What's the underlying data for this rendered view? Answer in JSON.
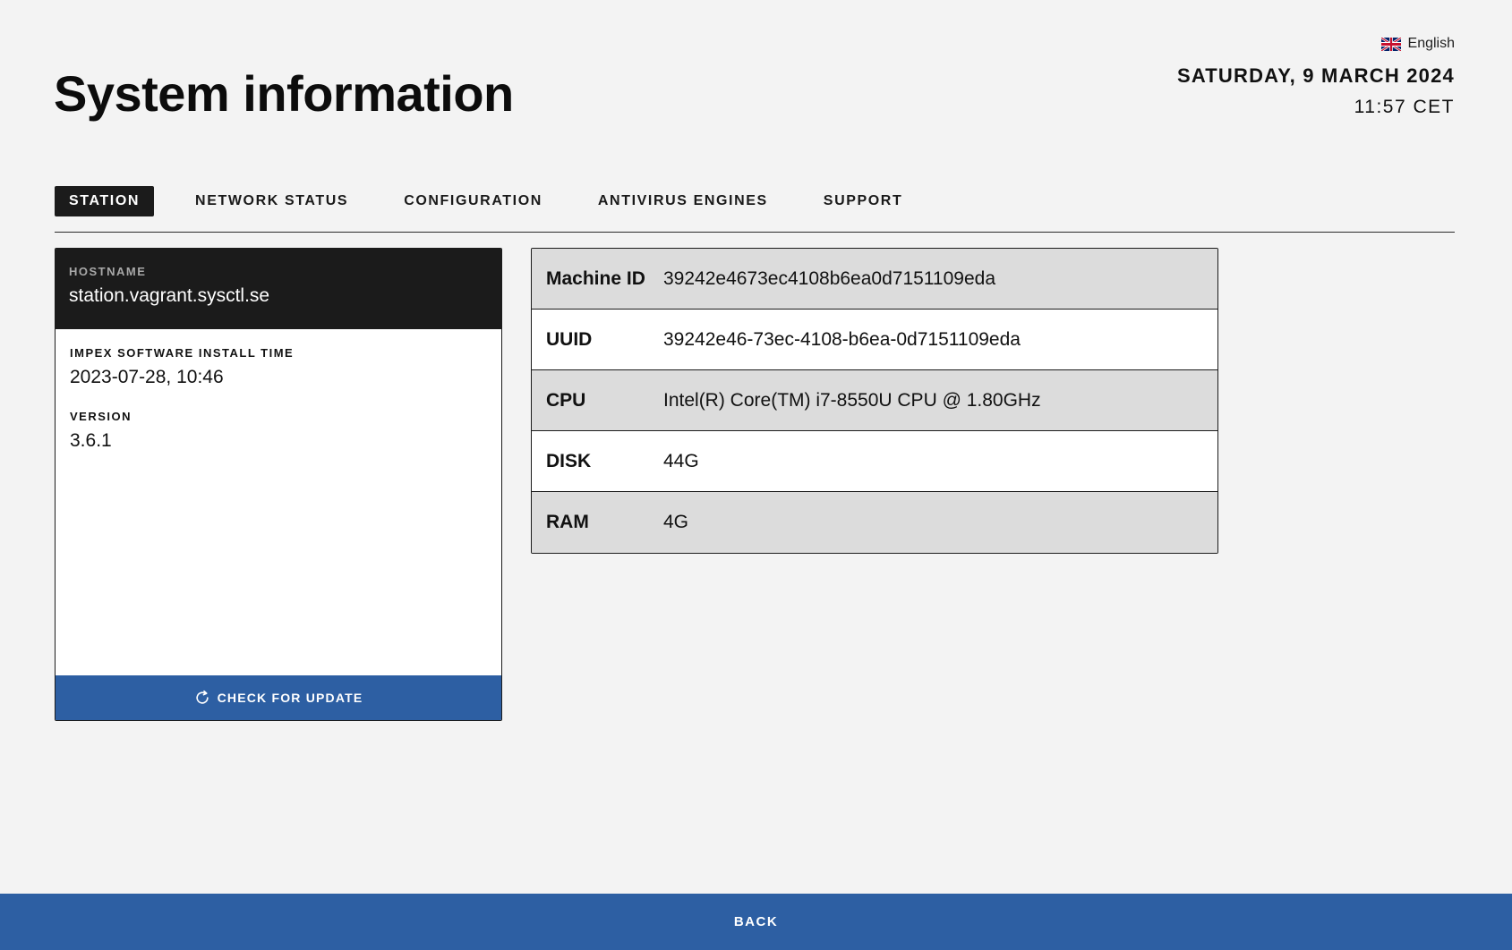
{
  "header": {
    "title": "System information",
    "language": "English",
    "date": "SATURDAY, 9 MARCH 2024",
    "time": "11:57 CET"
  },
  "tabs": [
    {
      "label": "STATION",
      "active": true
    },
    {
      "label": "NETWORK STATUS",
      "active": false
    },
    {
      "label": "CONFIGURATION",
      "active": false
    },
    {
      "label": "ANTIVIRUS ENGINES",
      "active": false
    },
    {
      "label": "SUPPORT",
      "active": false
    }
  ],
  "station": {
    "hostname_label": "HOSTNAME",
    "hostname": "station.vagrant.sysctl.se",
    "install_time_label": "IMPEX SOFTWARE INSTALL TIME",
    "install_time": "2023-07-28, 10:46",
    "version_label": "VERSION",
    "version": "3.6.1",
    "update_button": "CHECK FOR UPDATE"
  },
  "info": [
    {
      "key": "Machine ID",
      "value": "39242e4673ec4108b6ea0d7151109eda"
    },
    {
      "key": "UUID",
      "value": "39242e46-73ec-4108-b6ea-0d7151109eda"
    },
    {
      "key": "CPU",
      "value": "Intel(R) Core(TM) i7-8550U CPU @ 1.80GHz"
    },
    {
      "key": "DISK",
      "value": "44G"
    },
    {
      "key": "RAM",
      "value": "4G"
    }
  ],
  "footer": {
    "back_label": "BACK"
  },
  "colors": {
    "accent": "#2d5fa3",
    "dark": "#1b1b1b",
    "background": "#f3f3f3",
    "row_shade": "#dcdcdc"
  },
  "icons": {
    "language": "uk-flag-icon",
    "update": "refresh-icon"
  }
}
